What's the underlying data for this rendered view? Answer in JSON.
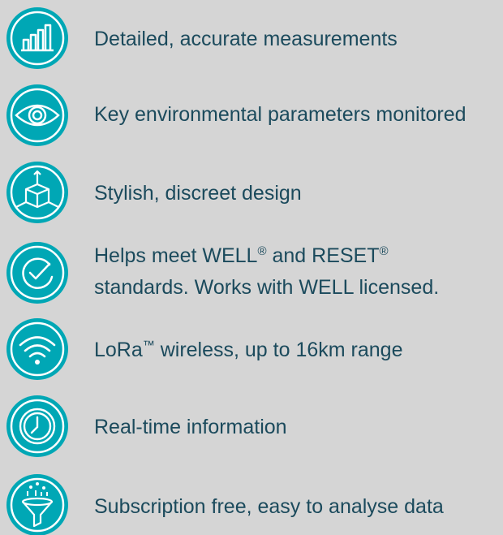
{
  "features": [
    {
      "icon": "bar-chart-icon",
      "text": "Detailed, accurate measurements"
    },
    {
      "icon": "eye-icon",
      "text": "Key environmental parameters monitored"
    },
    {
      "icon": "cube-dimensions-icon",
      "text": "Stylish, discreet design"
    },
    {
      "icon": "certified-check-icon",
      "line1_a": "Helps meet WELL",
      "line1_sup1": "®",
      "line1_b": " and RESET",
      "line1_sup2": "®",
      "line2": "standards. Works with WELL licensed."
    },
    {
      "icon": "wifi-icon",
      "text_a": "LoRa",
      "text_sup": "™",
      "text_b": " wireless, up to 16km range"
    },
    {
      "icon": "clock-icon",
      "text": "Real-time information"
    },
    {
      "icon": "funnel-icon",
      "text": "Subscription free, easy to analyse data"
    }
  ],
  "colors": {
    "background": "#d5d5d5",
    "text": "#1b4a5c",
    "icon_fill": "#00a7b5",
    "icon_stroke": "#ffffff"
  }
}
